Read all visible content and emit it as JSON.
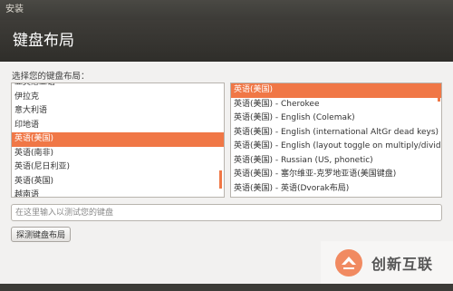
{
  "window": {
    "title": "安装"
  },
  "header": {
    "title": "键盘布局"
  },
  "prompt": "选择您的键盘布局：",
  "layouts": [
    {
      "label": "亚美尼亚语",
      "selected": false
    },
    {
      "label": "伊拉克",
      "selected": false
    },
    {
      "label": "意大利语",
      "selected": false
    },
    {
      "label": "印地语",
      "selected": false
    },
    {
      "label": "英语(美国)",
      "selected": true
    },
    {
      "label": "英语(南非)",
      "selected": false
    },
    {
      "label": "英语(尼日利亚)",
      "selected": false
    },
    {
      "label": "英语(英国)",
      "selected": false
    },
    {
      "label": "越南语",
      "selected": false
    }
  ],
  "variants": [
    {
      "label": "英语(美国)",
      "selected": true
    },
    {
      "label": "英语(美国) - Cherokee",
      "selected": false
    },
    {
      "label": "英语(美国) - English (Colemak)",
      "selected": false
    },
    {
      "label": "英语(美国) - English (international AltGr dead keys)",
      "selected": false
    },
    {
      "label": "英语(美国) - English (layout toggle on multiply/divide",
      "selected": false
    },
    {
      "label": "英语(美国) - Russian (US, phonetic)",
      "selected": false
    },
    {
      "label": "英语(美国) - 塞尔维亚-克罗地亚语(美国键盘)",
      "selected": false
    },
    {
      "label": "英语(美国) - 英语(Dvorak布局)",
      "selected": false
    }
  ],
  "test_input": {
    "placeholder": "在这里输入以测试您的键盘",
    "value": ""
  },
  "detect_button": {
    "label": "探测键盘布局"
  },
  "watermark": {
    "text": "创新互联"
  },
  "colors": {
    "accent": "#f07746",
    "header_bg": "#3c3b37",
    "content_bg": "#f2f1f0"
  }
}
